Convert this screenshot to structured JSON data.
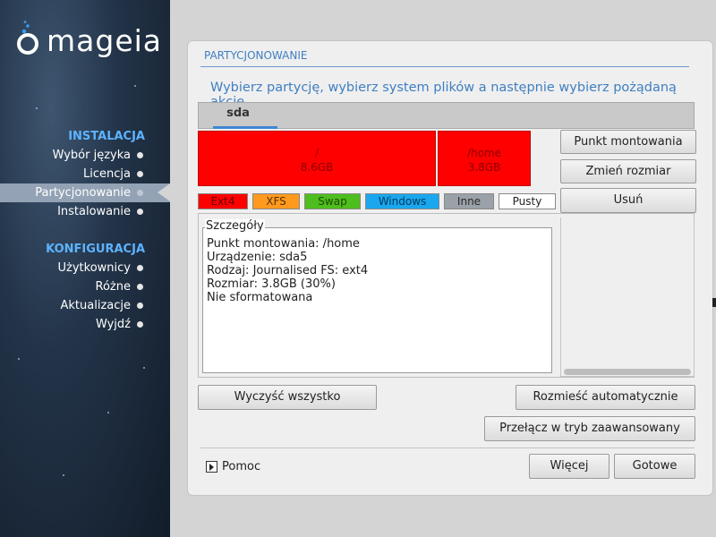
{
  "sidebar": {
    "brand": "mageia",
    "sections": [
      {
        "title": "INSTALACJA",
        "items": [
          {
            "label": "Wybór języka",
            "active": false
          },
          {
            "label": "Licencja",
            "active": false
          },
          {
            "label": "Partycjonowanie",
            "active": true
          },
          {
            "label": "Instalowanie",
            "active": false
          }
        ]
      },
      {
        "title": "KONFIGURACJA",
        "items": [
          {
            "label": "Użytkownicy",
            "active": false
          },
          {
            "label": "Różne",
            "active": false
          },
          {
            "label": "Aktualizacje",
            "active": false
          },
          {
            "label": "Wyjdź",
            "active": false
          }
        ]
      }
    ]
  },
  "main": {
    "title": "PARTYCJONOWANIE",
    "instruction": "Wybierz partycję, wybierz system plików a następnie wybierz pożądaną akcję",
    "disk_tab": "sda",
    "partitions": [
      {
        "mount": "/",
        "size": "8.6GB",
        "fs": "Ext4",
        "color": "#ff0000"
      },
      {
        "mount": "/home",
        "size": "3.8GB",
        "fs": "Ext4",
        "color": "#ff0000"
      }
    ],
    "legend": [
      {
        "label": "Ext4",
        "color": "#ff0000"
      },
      {
        "label": "XFS",
        "color": "#ff9a1f"
      },
      {
        "label": "Swap",
        "color": "#4dbe1d"
      },
      {
        "label": "Windows",
        "color": "#1aa7ee"
      },
      {
        "label": "Inne",
        "color": "#9aa1a8"
      },
      {
        "label": "Pusty",
        "color": "#ffffff"
      }
    ],
    "actions": {
      "mount_point": "Punkt montowania",
      "resize": "Zmień rozmiar",
      "delete": "Usuń"
    },
    "details": {
      "legend": "Szczegóły",
      "lines": [
        "Punkt montowania: /home",
        "Urządzenie: sda5",
        "Rodzaj: Journalised FS: ext4",
        "Rozmiar: 3.8GB (30%)",
        "Nie sformatowana"
      ]
    },
    "buttons": {
      "clear_all": "Wyczyść wszystko",
      "auto_allocate": "Rozmieść automatycznie",
      "advanced_mode": "Przełącz w tryb zaawansowany",
      "help": "Pomoc",
      "more": "Więcej",
      "done": "Gotowe"
    }
  }
}
